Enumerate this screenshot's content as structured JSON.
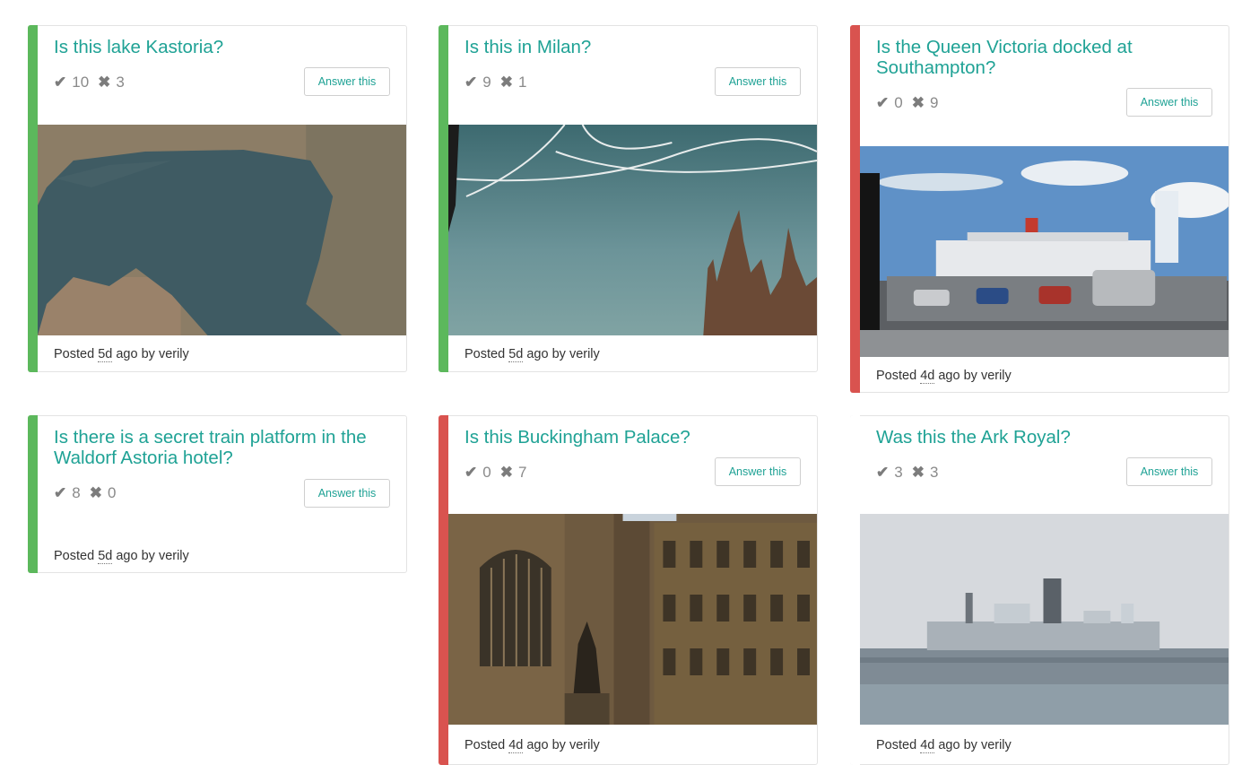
{
  "answer_label": "Answer this",
  "posted_prefix": "Posted",
  "posted_middle": "ago by",
  "cards": [
    {
      "title": "Is this lake Kastoria?",
      "yes": "10",
      "no": "3",
      "age": "5d",
      "author": "verily",
      "status": "green",
      "image": "lake-aerial-image"
    },
    {
      "title": "Is this in Milan?",
      "yes": "9",
      "no": "1",
      "age": "5d",
      "author": "verily",
      "status": "green",
      "image": "cathedral-sky-image"
    },
    {
      "title": "Is the Queen Victoria docked at Southampton?",
      "yes": "0",
      "no": "9",
      "age": "4d",
      "author": "verily",
      "status": "red",
      "image": "cruise-ship-port-image"
    },
    {
      "title": "Is there is a secret train platform in the Waldorf Astoria hotel?",
      "yes": "8",
      "no": "0",
      "age": "5d",
      "author": "verily",
      "status": "green",
      "image": null
    },
    {
      "title": "Is this Buckingham Palace?",
      "yes": "0",
      "no": "7",
      "age": "4d",
      "author": "verily",
      "status": "red",
      "image": "gothic-palace-image"
    },
    {
      "title": "Was this the Ark Royal?",
      "yes": "3",
      "no": "3",
      "age": "4d",
      "author": "verily",
      "status": "green",
      "image": "aircraft-carrier-image"
    }
  ],
  "colors": {
    "accent_green": "#5cb85c",
    "accent_red": "#d9534f",
    "title": "#1fa295"
  },
  "icons": {
    "yes": "check-icon",
    "no": "cross-icon"
  }
}
